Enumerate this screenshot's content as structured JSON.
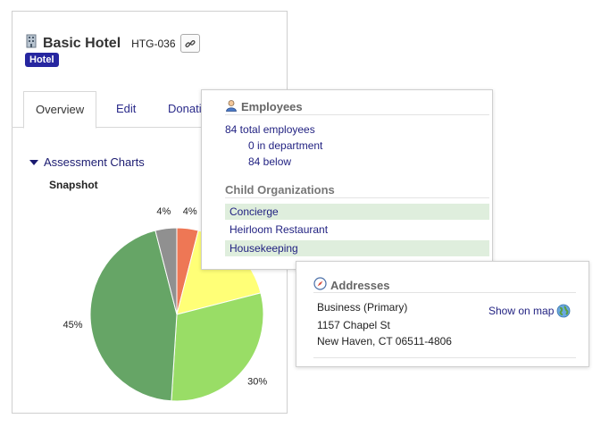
{
  "org": {
    "name": "Basic Hotel",
    "code": "HTG-036",
    "badge": "Hotel"
  },
  "tabs": [
    {
      "label": "Overview",
      "active": true
    },
    {
      "label": "Edit",
      "active": false
    },
    {
      "label": "Donati",
      "active": false
    }
  ],
  "assessment": {
    "heading": "Assessment Charts",
    "snapshot_label": "Snapshot"
  },
  "chart_data": {
    "type": "pie",
    "title": "Snapshot",
    "slices": [
      {
        "label": "4%",
        "value": 4,
        "color": "#ee7755"
      },
      {
        "label": "",
        "value": 17,
        "color": "#ffff77"
      },
      {
        "label": "30%",
        "value": 30,
        "color": "#99dd66"
      },
      {
        "label": "45%",
        "value": 45,
        "color": "#66a566"
      },
      {
        "label": "4%",
        "value": 4,
        "color": "#909090"
      }
    ]
  },
  "employees": {
    "title": "Employees",
    "total": "84 total employees",
    "in_department": "0 in department",
    "below": "84 below"
  },
  "child_orgs": {
    "title": "Child Organizations",
    "items": [
      "Concierge",
      "Heirloom Restaurant",
      "Housekeeping"
    ]
  },
  "addresses": {
    "title": "Addresses",
    "type": "Business (Primary)",
    "street": "1157 Chapel St",
    "city": "New Haven, CT 06511-4806",
    "map_link": "Show on map"
  },
  "icons": {
    "building": "building-icon",
    "link": "link-icon",
    "person": "person-icon",
    "compass": "compass-icon",
    "globe": "globe-icon"
  }
}
